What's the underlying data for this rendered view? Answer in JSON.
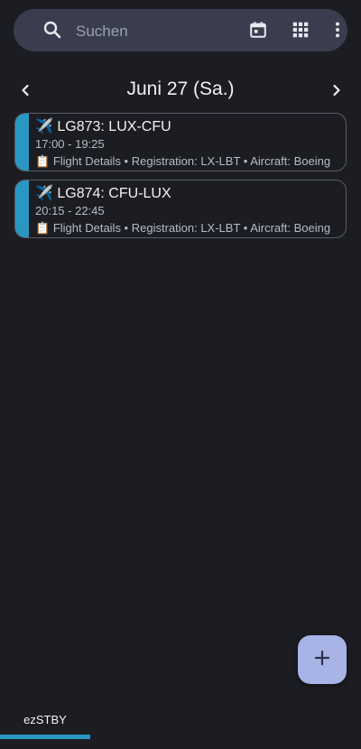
{
  "search": {
    "placeholder": "Suchen"
  },
  "toolbar": {
    "icons": [
      "calendar-icon",
      "grid-icon",
      "more-vertical-icon"
    ]
  },
  "date_header": {
    "title": "Juni 27 (Sa.)"
  },
  "events": [
    {
      "icon": "✈️",
      "title": "LG873: LUX-CFU",
      "time": "17:00 - 19:25",
      "details_icon": "📋",
      "details": "Flight Details • Registration: LX-LBT • Aircraft: Boeing"
    },
    {
      "icon": "✈️",
      "title": "LG874: CFU-LUX",
      "time": "20:15 - 22:45",
      "details_icon": "📋",
      "details": "Flight Details • Registration: LX-LBT • Aircraft: Boeing"
    }
  ],
  "fab": {
    "icon": "plus-icon"
  },
  "tabs": [
    {
      "label": "ezSTBY",
      "active": true
    }
  ],
  "colors": {
    "background": "#1c1d22",
    "search_bar": "#3a3d4d",
    "accent": "#2a97c2",
    "fab": "#a9b4e6"
  }
}
